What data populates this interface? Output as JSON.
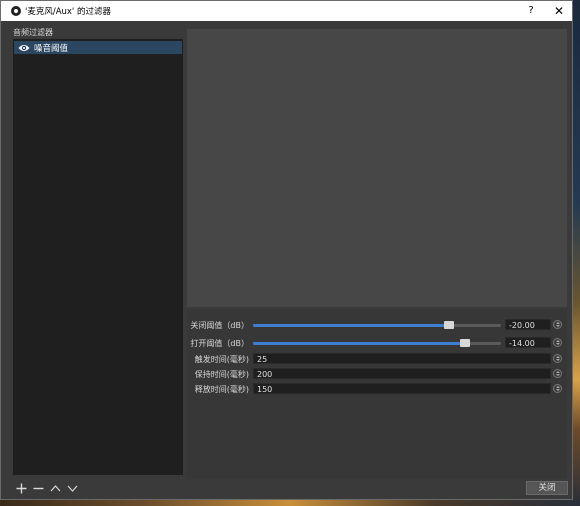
{
  "window": {
    "title": "'麦克风/Aux' 的过滤器",
    "help_label": "?",
    "close_label": "✕"
  },
  "filters_panel": {
    "header": "音频过滤器",
    "items": [
      {
        "label": "噪音阈值",
        "visible": true
      }
    ]
  },
  "properties": {
    "close_threshold": {
      "label": "关闭阈值（dB）",
      "value": "-20.00",
      "min": -96,
      "max": 0,
      "number": -20.0
    },
    "open_threshold": {
      "label": "打开阈值（dB）",
      "value": "-14.00",
      "min": -96,
      "max": 0,
      "number": -14.0
    },
    "attack_time": {
      "label": "触发时间(毫秒)",
      "value": "25"
    },
    "hold_time": {
      "label": "保持时间(毫秒)",
      "value": "200"
    },
    "release_time": {
      "label": "释放时间(毫秒)",
      "value": "150"
    }
  },
  "footer": {
    "close_button": "关闭"
  },
  "colors": {
    "accent": "#3f7fd0",
    "selection": "#2b4661",
    "background": "#3a3a3a"
  }
}
